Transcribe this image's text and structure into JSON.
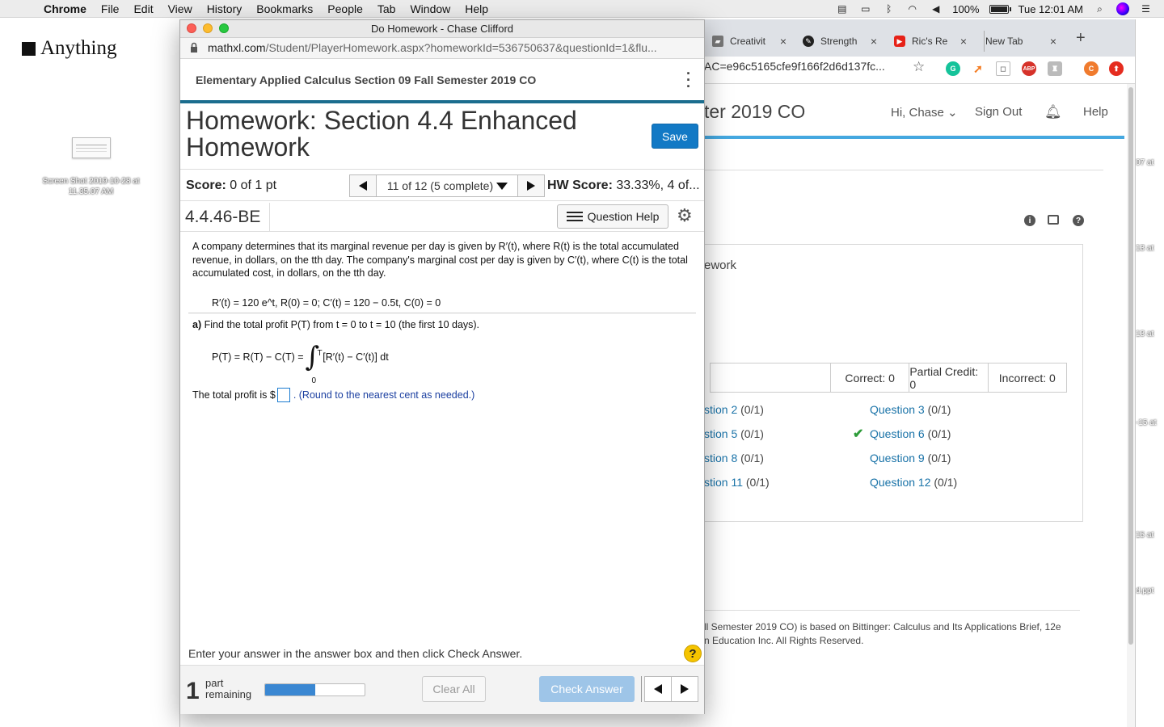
{
  "menubar": {
    "app": "Chrome",
    "items": [
      "File",
      "Edit",
      "View",
      "History",
      "Bookmarks",
      "People",
      "Tab",
      "Window",
      "Help"
    ],
    "battery": "100%",
    "clock": "Tue 12:01 AM"
  },
  "desktop": {
    "note": "Anything",
    "file_label": "Screen Shot 2019-10-28 at 11.35.07 AM",
    "edge_labels": [
      "07 at",
      "13 at",
      "13 at",
      "-15 at",
      "15 at",
      "d.ppt"
    ]
  },
  "bg_window": {
    "tabs": [
      {
        "label": "Creativit",
        "icon": "creative-icon"
      },
      {
        "label": "Strength",
        "icon": "strength-icon"
      },
      {
        "label": "Ric's Re",
        "icon": "youtube-icon"
      },
      {
        "label": "New Tab",
        "icon": ""
      }
    ],
    "url_fragment": "AC=e96c5165cfe9f166f2d6d137fc...",
    "heading_fragment": "ter 2019 CO",
    "nav": {
      "greeting": "Hi, Chase ⌄",
      "signout": "Sign Out",
      "help": "Help"
    },
    "panel_word": "ework",
    "stats": {
      "correct": "Correct: 0",
      "partial": "Partial Credit: 0",
      "incorrect": "Incorrect: 0"
    },
    "questions": [
      {
        "label": "stion 2",
        "score": "(0/1)"
      },
      {
        "label": "Question 3",
        "score": "(0/1)"
      },
      {
        "label": "stion 5",
        "score": "(0/1)"
      },
      {
        "label": "Question 6",
        "score": "(0/1)"
      },
      {
        "label": "stion 8",
        "score": "(0/1)"
      },
      {
        "label": "Question 9",
        "score": "(0/1)"
      },
      {
        "label": "stion 11",
        "score": "(0/1)"
      },
      {
        "label": "Question 12",
        "score": "(0/1)"
      }
    ],
    "footer_line1": "ll Semester 2019 CO) is based on Bittinger: Calculus and Its Applications Brief, 12e",
    "footer_line2": "n Education Inc. All Rights Reserved."
  },
  "popup": {
    "window_title": "Do Homework - Chase Clifford",
    "url_host": "mathxl.com",
    "url_path": "/Student/PlayerHomework.aspx?homeworkId=536750637&questionId=1&flu...",
    "course": "Elementary Applied Calculus Section 09 Fall Semester 2019 CO",
    "hw_title": "Homework: Section 4.4 Enhanced Homework",
    "save_label": "Save",
    "score_label": "Score:",
    "score_value": "0 of 1 pt",
    "question_nav": "11 of 12 (5 complete)",
    "hw_score_label": "HW Score:",
    "hw_score_value": "33.33%, 4 of...",
    "question_id": "4.4.46-BE",
    "question_help": "Question Help",
    "question_text": "A company determines that its marginal revenue per day is given by R′(t), where R(t) is the total accumulated revenue, in dollars, on the tth day. The company's marginal cost per day is given by C′(t), where C(t) is the total accumulated cost, in dollars, on the tth day.",
    "given": "R′(t) = 120 e^t, R(0) = 0; C′(t) = 120 − 0.5t, C(0) = 0",
    "part_a_label": "a)",
    "part_a": "Find the total profit P(T) from t = 0 to t = 10 (the first 10 days).",
    "formula_left": "P(T) = R(T) − C(T) =",
    "formula_right": "[R′(t) − C′(t)] dt",
    "integral_upper": "T",
    "integral_lower": "0",
    "answer_prefix": "The total profit is $",
    "answer_value": "",
    "answer_hint": ". (Round to the nearest cent as needed.)",
    "instruction": "Enter your answer in the answer box and then click Check Answer.",
    "parts_count": "1",
    "parts_label": "part remaining",
    "progress_fraction": 0.5,
    "clear_label": "Clear All",
    "check_label": "Check Answer"
  }
}
